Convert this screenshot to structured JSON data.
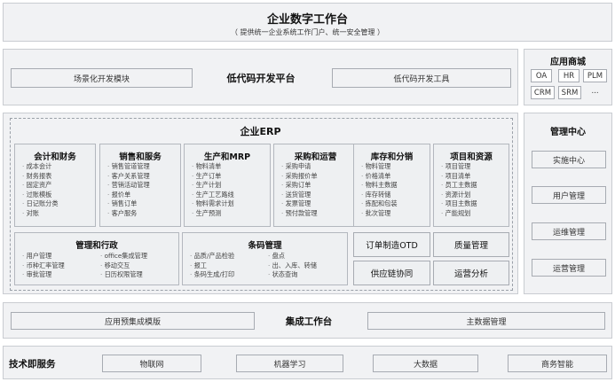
{
  "platform": {
    "title": "企业数字工作台",
    "subtitle": "（ 提供统一企业系统工作门户、统一安全管理 ）"
  },
  "lowcode": {
    "title": "低代码开发平台",
    "left_box": "场景化开发模块",
    "right_box": "低代码开发工具"
  },
  "erp": {
    "title": "企业ERP",
    "modules": [
      {
        "title": "会计和财务",
        "items": [
          "成本会计",
          "财务报表",
          "固定资产",
          "过账模板",
          "日记账分类",
          "对账"
        ]
      },
      {
        "title": "销售和服务",
        "items": [
          "销售管道管理",
          "客户关系管理",
          "营销活动管理",
          "报价单",
          "销售订单",
          "客户服务"
        ]
      },
      {
        "title": "生产和MRP",
        "items": [
          "物料清单",
          "生产订单",
          "生产计划",
          "生产工艺路线",
          "物料需求计划",
          "生产预测"
        ]
      },
      {
        "title": "采购和运营",
        "items": [
          "采购申请",
          "采购报价单",
          "采购订单",
          "送货管理",
          "发票管理",
          "预付款管理"
        ]
      },
      {
        "title": "库存和分销",
        "items": [
          "物料管理",
          "价格清单",
          "物料主数据",
          "库存转储",
          "拣配和包装",
          "批次管理"
        ]
      },
      {
        "title": "项目和资源",
        "items": [
          "项目管理",
          "项目清单",
          "员工主数据",
          "资源计划",
          "项目主数据",
          "产能规划"
        ]
      }
    ],
    "admin": {
      "title": "管理和行政",
      "col1": [
        "用户管理",
        "币种汇率管理",
        "审批管理"
      ],
      "col2": [
        "office集成管理",
        "移动交互",
        "日历权限管理"
      ]
    },
    "barcode": {
      "title": "条码管理",
      "col1": [
        "品质/产品检验",
        "报工",
        "条码生成/打印"
      ],
      "col2": [
        "盘点",
        "出、入库、转储",
        "状态查询"
      ]
    },
    "otd": "订单制造OTD",
    "quality": "质量管理",
    "supply": "供应链协同",
    "ops_analysis": "运营分析"
  },
  "app_store": {
    "title": "应用商城",
    "apps": [
      "OA",
      "HR",
      "PLM",
      "CRM",
      "SRM",
      "..."
    ]
  },
  "mgmt_center": {
    "title": "管理中心",
    "items": [
      "实施中心",
      "用户管理",
      "运维管理",
      "运营管理"
    ]
  },
  "integration": {
    "title": "集成工作台",
    "left_box": "应用预集成模版",
    "right_box": "主数据管理"
  },
  "tech": {
    "title": "技术即服务",
    "items": [
      "物联网",
      "机器学习",
      "大数据",
      "商务智能"
    ]
  }
}
